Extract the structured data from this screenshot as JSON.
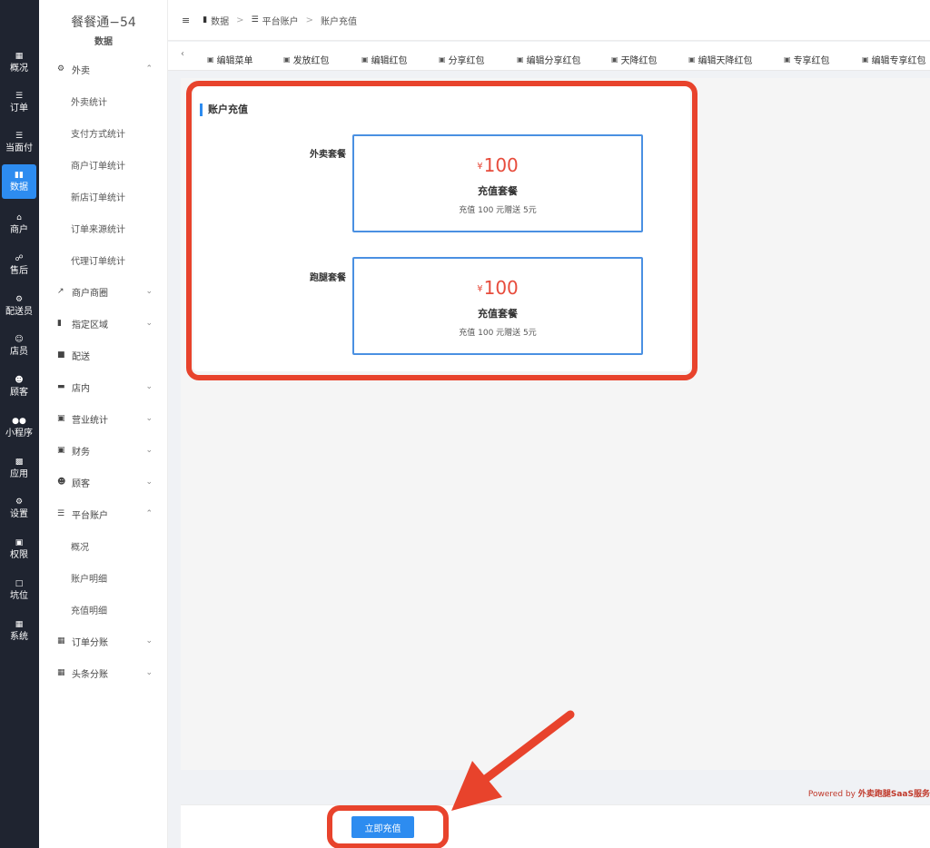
{
  "rail": {
    "items": [
      {
        "label": "概况",
        "icon": "grid-icon"
      },
      {
        "label": "订单",
        "icon": "list-icon"
      },
      {
        "label": "当面付",
        "icon": "list-icon"
      },
      {
        "label": "数据",
        "icon": "bar-chart-icon"
      },
      {
        "label": "商户",
        "icon": "store-icon"
      },
      {
        "label": "售后",
        "icon": "headset-icon"
      },
      {
        "label": "配送员",
        "icon": "scooter-icon"
      },
      {
        "label": "店员",
        "icon": "staff-icon"
      },
      {
        "label": "顾客",
        "icon": "customer-icon"
      },
      {
        "label": "小程序",
        "icon": "wechat-icon"
      },
      {
        "label": "应用",
        "icon": "apps-icon"
      },
      {
        "label": "设置",
        "icon": "settings-icon"
      },
      {
        "label": "权限",
        "icon": "lock-icon"
      },
      {
        "label": "坑位",
        "icon": "file-icon"
      },
      {
        "label": "系统",
        "icon": "windows-icon"
      }
    ],
    "active": "数据"
  },
  "sidebar": {
    "brand": "餐餐通−54",
    "brand_sub": "数据",
    "groups": {
      "takeout": "外卖",
      "merchant_circle": "商户商圈",
      "region": "指定区域",
      "delivery": "配送",
      "instore": "店内",
      "business": "营业统计",
      "finance": "财务",
      "customer": "顾客",
      "platform": "平台账户",
      "order_split": "订单分账",
      "toutiao_split": "头条分账"
    },
    "takeout_items": [
      "外卖统计",
      "支付方式统计",
      "商户订单统计",
      "新店订单统计",
      "订单来源统计",
      "代理订单统计"
    ],
    "platform_items": [
      "概况",
      "账户明细",
      "充值明细"
    ]
  },
  "header": {
    "crumb1": "数据",
    "crumb2": "平台账户",
    "crumb3": "账户充值",
    "sep": ">"
  },
  "tabs": [
    "编辑菜单",
    "发放红包",
    "编辑红包",
    "分享红包",
    "编辑分享红包",
    "天降红包",
    "编辑天降红包",
    "专享红包",
    "编辑专享红包"
  ],
  "card": {
    "title": "账户充值",
    "packages": [
      {
        "label": "外卖套餐",
        "currency": "¥",
        "amount": "100",
        "name": "充值套餐",
        "desc": "充值 100 元赠送 5元"
      },
      {
        "label": "跑腿套餐",
        "currency": "¥",
        "amount": "100",
        "name": "充值套餐",
        "desc": "充值 100 元赠送 5元"
      }
    ]
  },
  "footer": {
    "powered_prefix": "Powered by ",
    "powered_brand": "外卖跑腿SaaS服务"
  },
  "action": {
    "recharge_label": "立即充值"
  },
  "colors": {
    "accent": "#2d8cf0",
    "annotation": "#e8432c",
    "price": "#e74c3c",
    "rail_bg": "#1f2430"
  }
}
